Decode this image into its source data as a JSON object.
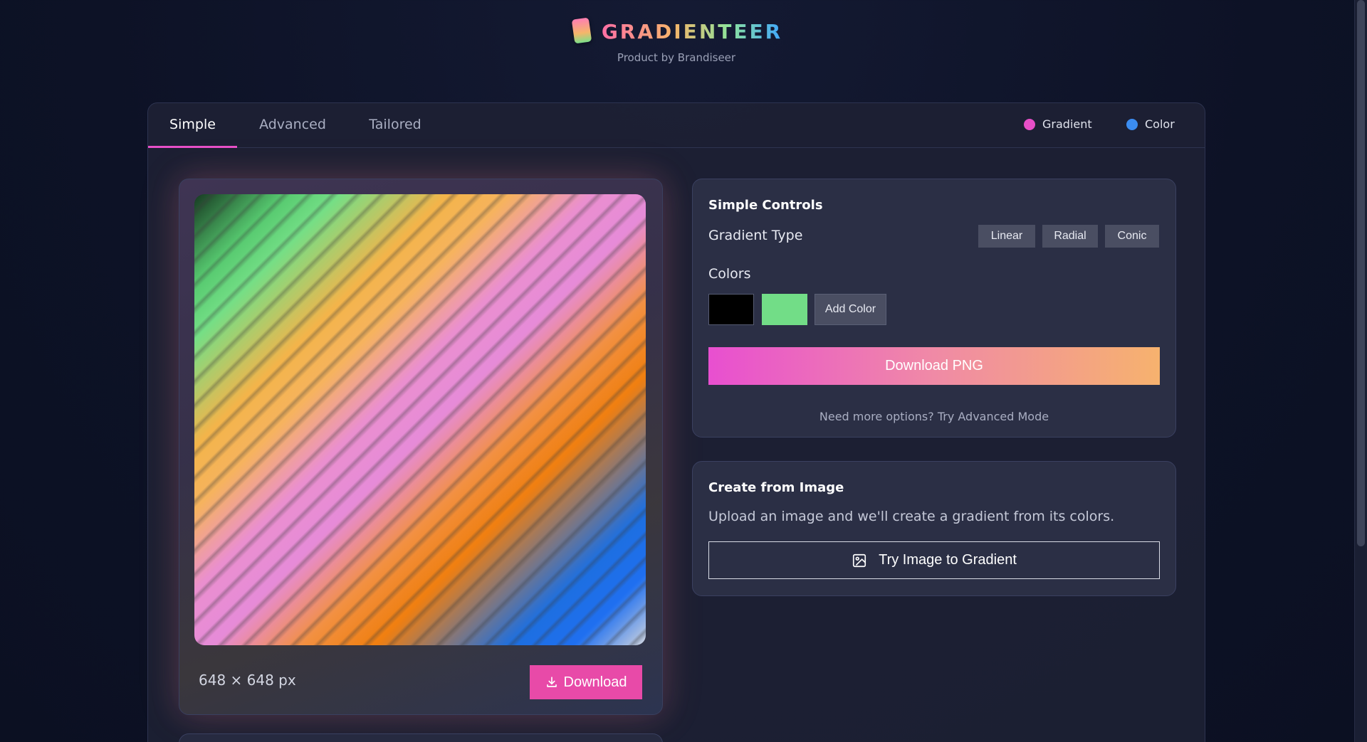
{
  "brand": {
    "name": "GRADIENTEER",
    "subtitle": "Product by Brandiseer"
  },
  "tabs": [
    {
      "label": "Simple",
      "active": true
    },
    {
      "label": "Advanced",
      "active": false
    },
    {
      "label": "Tailored",
      "active": false
    }
  ],
  "legend": [
    {
      "label": "Gradient",
      "color": "#e74fc8"
    },
    {
      "label": "Color",
      "color": "#3b8cf0"
    }
  ],
  "preview": {
    "size_label": "648 × 648 px",
    "download_label": "Download",
    "gradient_colors": [
      "#173a22",
      "#74df86",
      "#f3b44a",
      "#e68bd8",
      "#f07f10",
      "#1f6ff0",
      "#cfd4de"
    ]
  },
  "controls": {
    "title": "Simple Controls",
    "gradient_type_label": "Gradient Type",
    "gradient_types": [
      "Linear",
      "Radial",
      "Conic"
    ],
    "colors_label": "Colors",
    "swatches": [
      "#000000",
      "#72dd87"
    ],
    "add_color_label": "Add Color",
    "download_png_label": "Download PNG",
    "hint": "Need more options? Try Advanced Mode"
  },
  "image_card": {
    "title": "Create from Image",
    "description": "Upload an image and we'll create a gradient from its colors.",
    "button_label": "Try Image to Gradient"
  }
}
